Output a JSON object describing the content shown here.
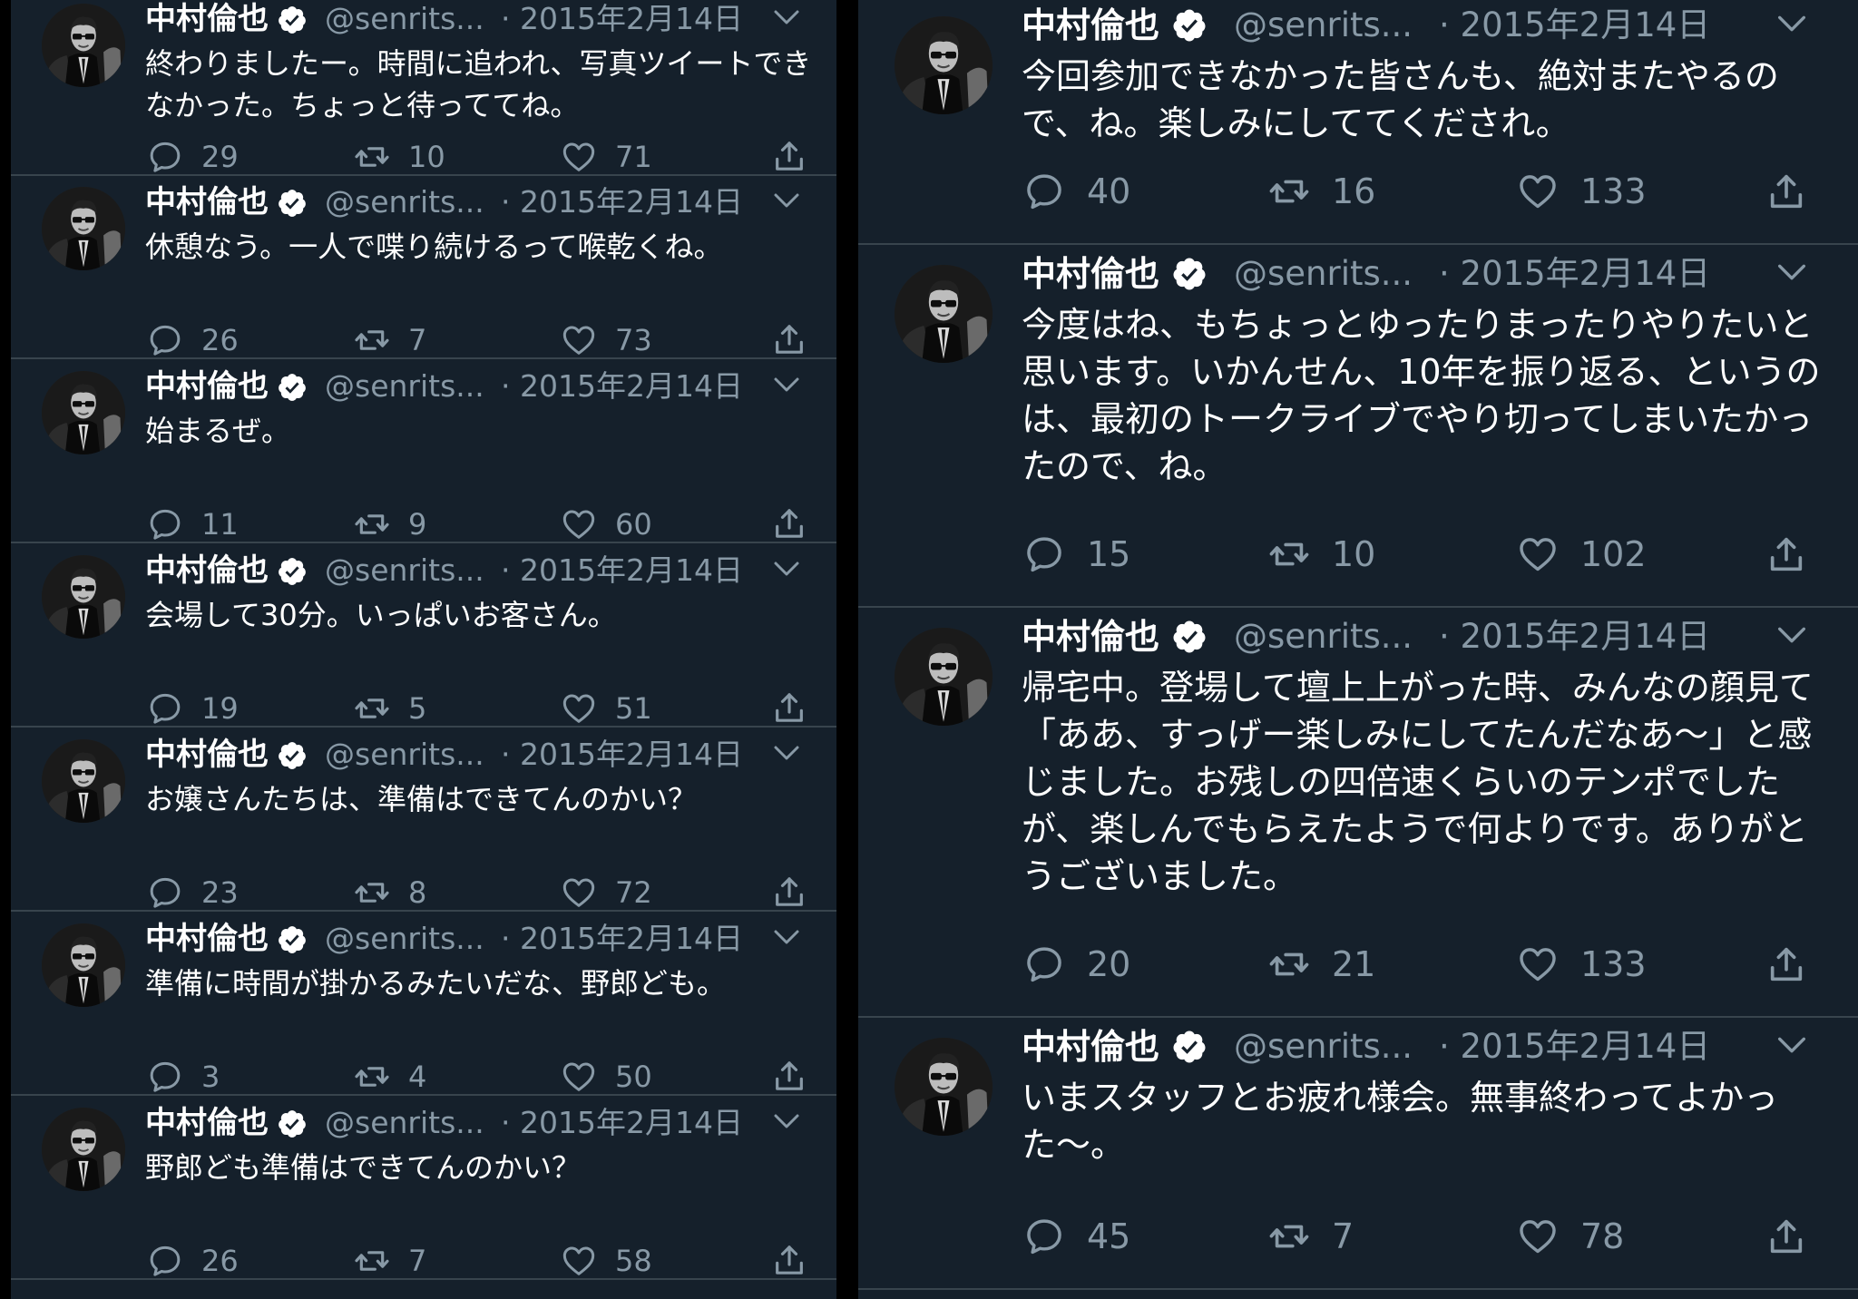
{
  "colors": {
    "background": "#15202b",
    "divider": "#38444d",
    "secondary_text": "#8899a6",
    "primary_text": "#ffffff"
  },
  "left_feed": [
    {
      "name": "中村倫也",
      "handle": "@senrits...",
      "date": "· 2015年2月14日",
      "text": "終わりましたー。時間に追われ、写真ツイートできなかった。ちょっと待っててね。",
      "replies": "29",
      "retweets": "10",
      "likes": "71"
    },
    {
      "name": "中村倫也",
      "handle": "@senrits...",
      "date": "· 2015年2月14日",
      "text": "休憩なう。一人で喋り続けるって喉乾くね。",
      "replies": "26",
      "retweets": "7",
      "likes": "73"
    },
    {
      "name": "中村倫也",
      "handle": "@senrits...",
      "date": "· 2015年2月14日",
      "text": "始まるぜ。",
      "replies": "11",
      "retweets": "9",
      "likes": "60"
    },
    {
      "name": "中村倫也",
      "handle": "@senrits...",
      "date": "· 2015年2月14日",
      "text": "会場して30分。いっぱいお客さん。",
      "replies": "19",
      "retweets": "5",
      "likes": "51"
    },
    {
      "name": "中村倫也",
      "handle": "@senrits...",
      "date": "· 2015年2月14日",
      "text": "お嬢さんたちは、準備はできてんのかい？",
      "replies": "23",
      "retweets": "8",
      "likes": "72"
    },
    {
      "name": "中村倫也",
      "handle": "@senrits...",
      "date": "· 2015年2月14日",
      "text": "準備に時間が掛かるみたいだな、野郎ども。",
      "replies": "3",
      "retweets": "4",
      "likes": "50"
    },
    {
      "name": "中村倫也",
      "handle": "@senrits...",
      "date": "· 2015年2月14日",
      "text": "野郎ども準備はできてんのかい？",
      "replies": "26",
      "retweets": "7",
      "likes": "58"
    }
  ],
  "right_feed": [
    {
      "name": "中村倫也",
      "handle": "@senrits...",
      "date": "· 2015年2月14日",
      "text": "今回参加できなかった皆さんも、絶対またやるので、ね。楽しみにしててくだされ。",
      "replies": "40",
      "retweets": "16",
      "likes": "133"
    },
    {
      "name": "中村倫也",
      "handle": "@senrits...",
      "date": "· 2015年2月14日",
      "text": "今度はね、もちょっとゆったりまったりやりたいと思います。いかんせん、10年を振り返る、というのは、最初のトークライブでやり切ってしまいたかったので、ね。",
      "replies": "15",
      "retweets": "10",
      "likes": "102"
    },
    {
      "name": "中村倫也",
      "handle": "@senrits...",
      "date": "· 2015年2月14日",
      "text": "帰宅中。登場して壇上上がった時、みんなの顔見て「ああ、すっげー楽しみにしてたんだなあ〜」と感じました。お残しの四倍速くらいのテンポでしたが、楽しんでもらえたようで何よりです。ありがとうございました。",
      "replies": "20",
      "retweets": "21",
      "likes": "133"
    },
    {
      "name": "中村倫也",
      "handle": "@senrits...",
      "date": "· 2015年2月14日",
      "text": "いまスタッフとお疲れ様会。無事終わってよかった〜。",
      "replies": "45",
      "retweets": "7",
      "likes": "78"
    }
  ]
}
